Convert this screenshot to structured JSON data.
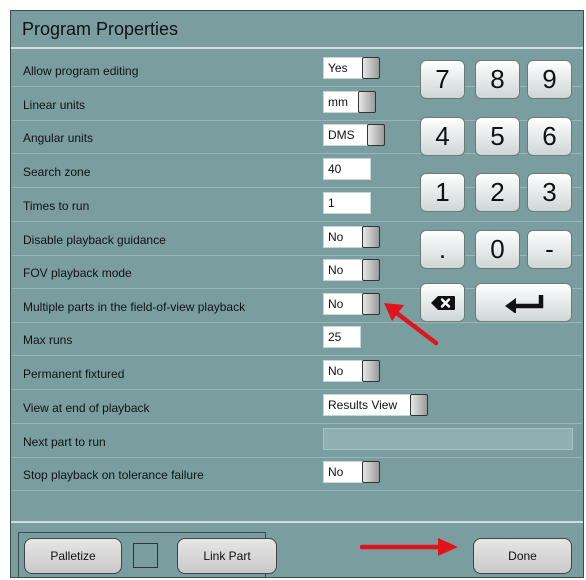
{
  "window": {
    "title": "Program Properties"
  },
  "properties": [
    {
      "label": "Allow program editing",
      "value": "Yes",
      "control": "toggle"
    },
    {
      "label": "Linear units",
      "value": "mm",
      "control": "toggle"
    },
    {
      "label": "Angular units",
      "value": "DMS",
      "control": "toggle"
    },
    {
      "label": "Search zone",
      "value": "40",
      "control": "input"
    },
    {
      "label": "Times to run",
      "value": "1",
      "control": "input"
    },
    {
      "label": "Disable playback guidance",
      "value": "No",
      "control": "toggle"
    },
    {
      "label": "FOV playback mode",
      "value": "No",
      "control": "toggle"
    },
    {
      "label": "Multiple parts in the field-of-view playback",
      "value": "No",
      "control": "toggle"
    },
    {
      "label": "Max runs",
      "value": "25",
      "control": "input"
    },
    {
      "label": "Permanent fixtured",
      "value": "No",
      "control": "toggle"
    },
    {
      "label": "View at end of playback",
      "value": "Results View",
      "control": "toggle"
    },
    {
      "label": "Next part to run",
      "value": "",
      "control": "input"
    },
    {
      "label": "Stop playback on tolerance failure",
      "value": "No",
      "control": "toggle"
    }
  ],
  "keypad": {
    "keys": [
      "7",
      "8",
      "9",
      "4",
      "5",
      "6",
      "1",
      "2",
      "3",
      ".",
      "0",
      "-"
    ],
    "backspace_icon": "backspace-icon",
    "enter_icon": "enter-icon"
  },
  "footer": {
    "palletize_label": "Palletize",
    "link_part_label": "Link Part",
    "done_label": "Done"
  },
  "annotations": {
    "arrow_color": "#e0141a"
  }
}
